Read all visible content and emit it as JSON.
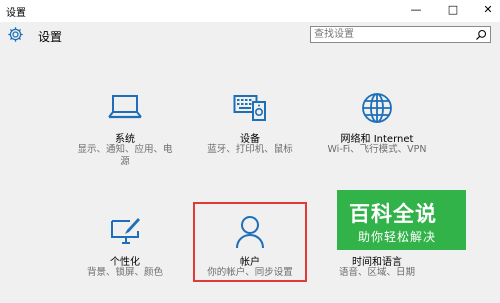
{
  "window": {
    "title": "设置",
    "minimize": "—",
    "maximize": "□",
    "close": "✕"
  },
  "header": {
    "title": "设置",
    "search_placeholder": "查找设置"
  },
  "tiles": [
    {
      "name": "系统",
      "desc": "显示、通知、应用、电\n源",
      "icon": "laptop-icon"
    },
    {
      "name": "设备",
      "desc": "蓝牙、打印机、鼠标",
      "icon": "devices-icon"
    },
    {
      "name": "网络和 Internet",
      "desc": "Wi-Fi、飞行模式、VPN",
      "icon": "globe-icon"
    },
    {
      "name": "个性化",
      "desc": "背景、锁屏、颜色",
      "icon": "personalization-icon"
    },
    {
      "name": "帐户",
      "desc": "你的帐户、同步设置",
      "icon": "person-icon"
    },
    {
      "name": "时间和语言",
      "desc": "语音、区域、日期",
      "icon": "time-language-icon"
    }
  ],
  "watermark": {
    "big": "百科全说",
    "small": "助你轻松解决"
  },
  "colors": {
    "accent": "#1e6fb8",
    "highlight": "#e03a3a",
    "watermark_bg": "#31b34a"
  }
}
